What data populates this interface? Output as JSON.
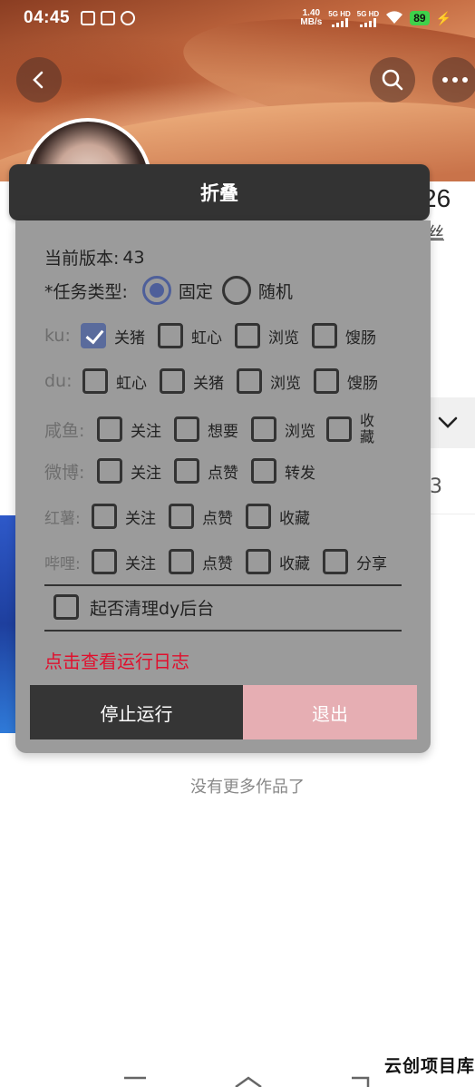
{
  "status_bar": {
    "time": "04:45",
    "net_speed": "1.40",
    "net_unit": "MB/s",
    "sim1": "5G HD",
    "sim2": "5G HD",
    "battery": "89"
  },
  "profile": {
    "stat_number_partial": "26",
    "fans_label_partial": "丝",
    "side_count_partial": "3",
    "footer_text": "没有更多作品了"
  },
  "overlay": {
    "fold_label": "折叠",
    "version_label": "当前版本:",
    "version_value": "43",
    "task_type_label": "*任务类型:",
    "task_types": [
      {
        "label": "固定",
        "selected": true
      },
      {
        "label": "随机",
        "selected": false
      }
    ],
    "platforms": [
      {
        "name": "ku:",
        "options": [
          {
            "label": "关猪",
            "checked": true
          },
          {
            "label": "虹心",
            "checked": false
          },
          {
            "label": "浏览",
            "checked": false
          },
          {
            "label": "馊肠",
            "checked": false
          }
        ]
      },
      {
        "name": "du:",
        "options": [
          {
            "label": "虹心",
            "checked": false
          },
          {
            "label": "关猪",
            "checked": false
          },
          {
            "label": "浏览",
            "checked": false
          },
          {
            "label": "馊肠",
            "checked": false
          }
        ]
      },
      {
        "name": "咸鱼:",
        "options": [
          {
            "label": "关注",
            "checked": false
          },
          {
            "label": "想要",
            "checked": false
          },
          {
            "label": "浏览",
            "checked": false
          },
          {
            "label": "收藏",
            "checked": false
          }
        ]
      },
      {
        "name": "微博:",
        "options": [
          {
            "label": "关注",
            "checked": false
          },
          {
            "label": "点赞",
            "checked": false
          },
          {
            "label": "转发",
            "checked": false
          }
        ]
      },
      {
        "name": "红薯:",
        "options": [
          {
            "label": "关注",
            "checked": false
          },
          {
            "label": "点赞",
            "checked": false
          },
          {
            "label": "收藏",
            "checked": false
          }
        ]
      },
      {
        "name": "哔哩:",
        "options": [
          {
            "label": "关注",
            "checked": false
          },
          {
            "label": "点赞",
            "checked": false
          },
          {
            "label": "收藏",
            "checked": false
          },
          {
            "label": "分享",
            "checked": false
          }
        ]
      }
    ],
    "clean_label": "起否清理dy后台",
    "log_link": "点击查看运行日志",
    "stop_button": "停止运行",
    "exit_button": "退出"
  },
  "watermark": "云创项目库",
  "colors": {
    "accent": "#5a6b9c",
    "panel_bg": "#9b9b9b",
    "fold_bg": "#333333",
    "log_link": "#e0102e",
    "exit_bg": "#e6aeb3"
  }
}
